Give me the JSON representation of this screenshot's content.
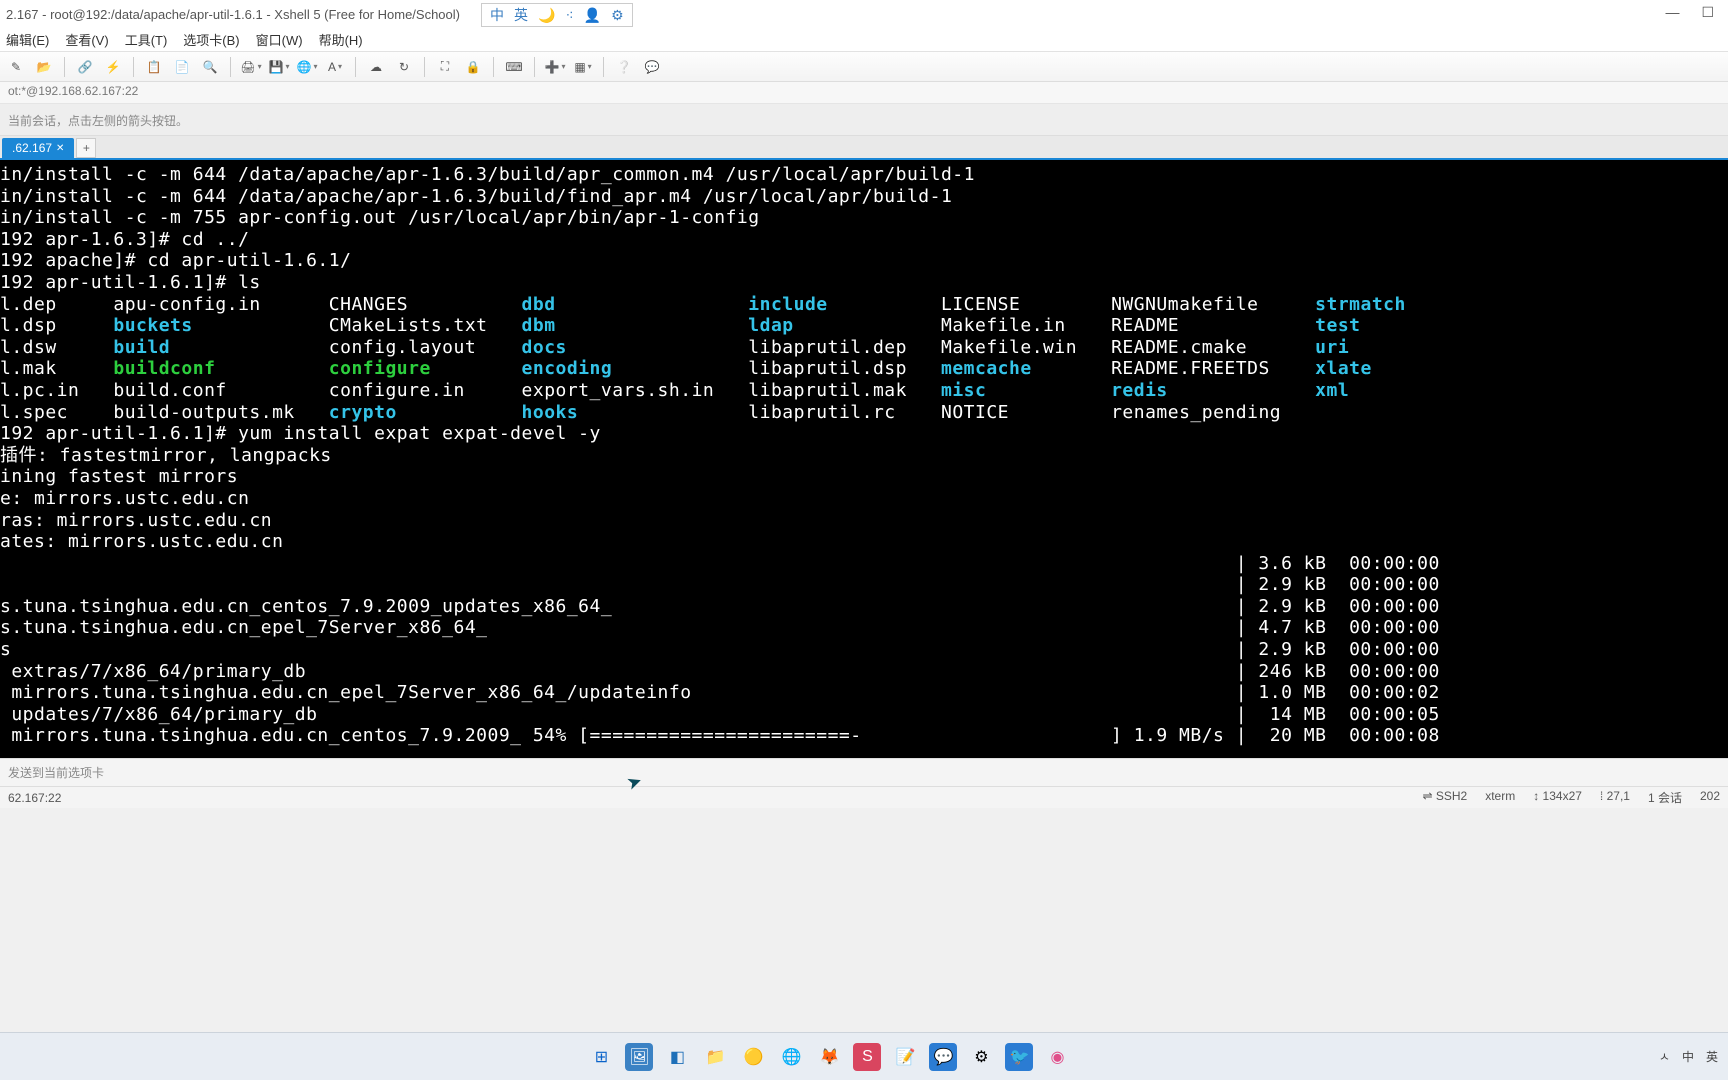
{
  "window": {
    "title": "2.167 - root@192:/data/apache/apr-util-1.6.1 - Xshell 5 (Free for Home/School)"
  },
  "ime": {
    "ch": "中",
    "en": "英"
  },
  "menu": {
    "edit": "编辑(E)",
    "view": "查看(V)",
    "tools": "工具(T)",
    "options": "选项卡(B)",
    "window": "窗口(W)",
    "help": "帮助(H)"
  },
  "address": "ot:*@192.168.62.167:22",
  "hint": "当前会话，点击左侧的箭头按钮。",
  "tab": {
    "label": ".62.167",
    "add": "+"
  },
  "term": {
    "l1": "in/install -c -m 644 /data/apache/apr-1.6.3/build/apr_common.m4 /usr/local/apr/build-1",
    "l2": "in/install -c -m 644 /data/apache/apr-1.6.3/build/find_apr.m4 /usr/local/apr/build-1",
    "l3": "in/install -c -m 755 apr-config.out /usr/local/apr/bin/apr-1-config",
    "l4": "192 apr-1.6.3]# cd ../",
    "l5": "192 apache]# cd apr-util-1.6.1/",
    "l6": "192 apr-util-1.6.1]# ls",
    "ls": {
      "c1": [
        "l.dep",
        "l.dsp",
        "l.dsw",
        "l.mak",
        "l.pc.in",
        "l.spec"
      ],
      "c2": [
        "apu-config.in",
        "buckets",
        "build",
        "buildconf",
        "build.conf",
        "build-outputs.mk"
      ],
      "c3": [
        "CHANGES",
        "CMakeLists.txt",
        "config.layout",
        "configure",
        "configure.in",
        "crypto"
      ],
      "c4": [
        "dbd",
        "dbm",
        "docs",
        "encoding",
        "export_vars.sh.in",
        "hooks"
      ],
      "c5": [
        "include",
        "ldap",
        "libaprutil.dep",
        "libaprutil.dsp",
        "libaprutil.mak",
        "libaprutil.rc"
      ],
      "c6": [
        "LICENSE",
        "Makefile.in",
        "Makefile.win",
        "memcache",
        "misc",
        "NOTICE"
      ],
      "c7": [
        "NWGNUmakefile",
        "README",
        "README.cmake",
        "README.FREETDS",
        "redis",
        "renames_pending"
      ],
      "c8": [
        "strmatch",
        "test",
        "uri",
        "xlate",
        "xml",
        ""
      ]
    },
    "l7": "192 apr-util-1.6.1]# yum install expat expat-devel -y",
    "l8": "插件: fastestmirror, langpacks",
    "l9": "ining fastest mirrors",
    "l10": "e: mirrors.ustc.edu.cn",
    "l11": "ras: mirrors.ustc.edu.cn",
    "l12": "ates: mirrors.ustc.edu.cn",
    "r1a": "",
    "r1b": "| 3.6 kB  00:00:00",
    "r2a": "",
    "r2b": "| 2.9 kB  00:00:00",
    "r3a": "s.tuna.tsinghua.edu.cn_centos_7.9.2009_updates_x86_64_",
    "r3b": "| 2.9 kB  00:00:00",
    "r4a": "s.tuna.tsinghua.edu.cn_epel_7Server_x86_64_",
    "r4b": "| 4.7 kB  00:00:00",
    "r5a": "s",
    "r5b": "| 2.9 kB  00:00:00",
    "r6a": " extras/7/x86_64/primary_db",
    "r6b": "| 246 kB  00:00:00",
    "r7a": " mirrors.tuna.tsinghua.edu.cn_epel_7Server_x86_64_/updateinfo",
    "r7b": "| 1.0 MB  00:00:02",
    "r8a": " updates/7/x86_64/primary_db",
    "r8b": "|  14 MB  00:00:05",
    "r9a": " mirrors.tuna.tsinghua.edu.cn_centos_7.9.2009_ 54% [=======================-",
    "r9b": "] 1.9 MB/s |  20 MB  00:00:08"
  },
  "send": "发送到当前选项卡",
  "status": {
    "left": "62.167:22",
    "ssh": "⇌ SSH2",
    "term": "xterm",
    "size": "↕ 134x27",
    "rc": "⁞ 27,1",
    "sess": "1 会话",
    "year": "202"
  },
  "tray": {
    "up": "ㅅ",
    "ch": "中",
    "en": "英"
  }
}
